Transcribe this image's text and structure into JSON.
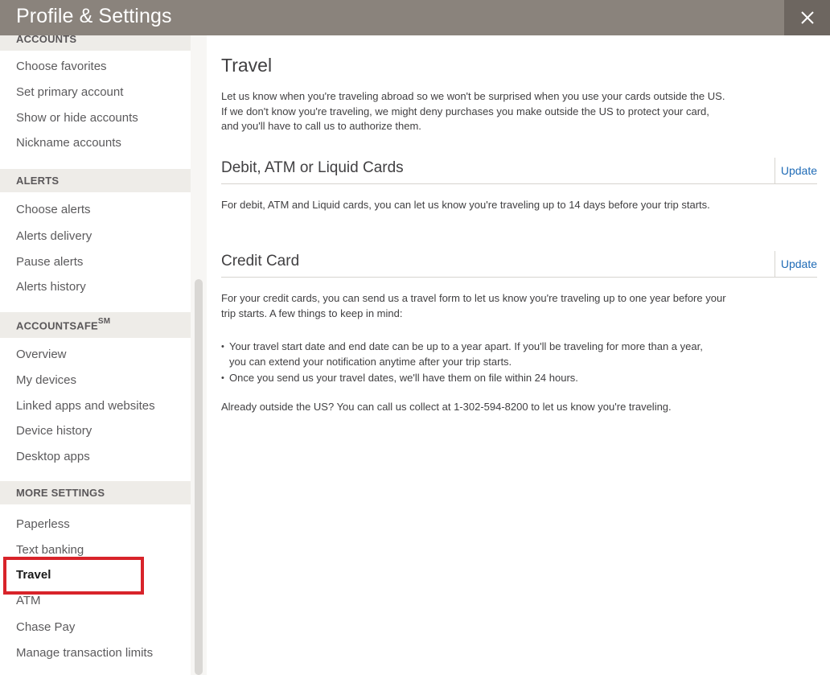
{
  "header": {
    "title": "Profile & Settings",
    "close_icon": "close-icon"
  },
  "sidebar": {
    "accounts": {
      "heading": "ACCOUNTS",
      "items": [
        "Choose favorites",
        "Set primary account",
        "Show or hide accounts",
        "Nickname accounts"
      ]
    },
    "alerts": {
      "heading": "ALERTS",
      "items": [
        "Choose alerts",
        "Alerts delivery",
        "Pause alerts",
        "Alerts history"
      ]
    },
    "accountsafe": {
      "heading": "ACCOUNTSAFE",
      "heading_sup": "SM",
      "items": [
        "Overview",
        "My devices",
        "Linked apps and websites",
        "Device history",
        "Desktop apps"
      ]
    },
    "more_settings": {
      "heading": "MORE SETTINGS",
      "items": [
        "Paperless",
        "Text banking",
        "Travel",
        "ATM",
        "Chase Pay",
        "Manage transaction limits"
      ]
    },
    "active_item": "Travel"
  },
  "main": {
    "title": "Travel",
    "intro": "Let us know when you're traveling abroad so we won't be surprised when you use your cards outside the US. If we don't know you're traveling, we might deny purchases you make outside the US to protect your card, and you'll have to call us to authorize them.",
    "debit": {
      "title": "Debit, ATM or Liquid Cards",
      "update_label": "Update",
      "text": "For debit, ATM and Liquid cards, you can let us know you're traveling up to 14 days before your trip starts."
    },
    "credit": {
      "title": "Credit Card",
      "update_label": "Update",
      "text": "For your credit cards, you can send us a travel form to let us know you're traveling up to one year before your trip starts. A few things to keep in mind:",
      "bullets": [
        "Your travel start date and end date can be up to a year apart. If you'll be traveling for more than a year, you can extend your notification anytime after your trip starts.",
        "Once you send us your travel dates, we'll have them on file within 24 hours."
      ],
      "footer": "Already outside the US? You can call us collect at 1-302-594-8200 to let us know you're traveling."
    }
  },
  "colors": {
    "header_bg": "#8a837c",
    "close_bg": "#6d6660",
    "link": "#1f6bb6",
    "highlight": "#d8232a",
    "section_bg": "#eeece8"
  }
}
